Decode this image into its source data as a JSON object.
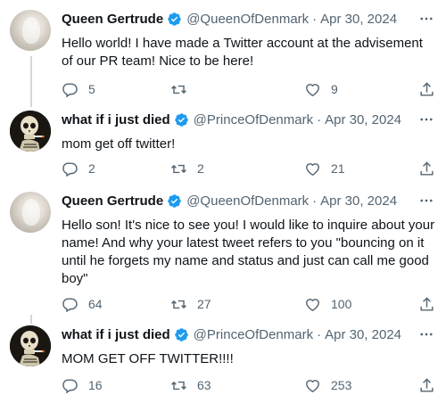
{
  "tweets": [
    {
      "name": "Queen Gertrude",
      "handle": "@QueenOfDenmark",
      "separator": "·",
      "date": "Apr 30, 2024",
      "text": "Hello world! I have made a Twitter account at the advisement of our PR team! Nice to be here!",
      "replies": "5",
      "retweets": "",
      "likes": "9",
      "avatar": "woman-portrait"
    },
    {
      "name": "what if i just died",
      "handle": "@PrinceOfDenmark",
      "separator": "·",
      "date": "Apr 30, 2024",
      "text": "mom get off twitter!",
      "replies": "2",
      "retweets": "2",
      "likes": "21",
      "avatar": "smoking-skeleton"
    },
    {
      "name": "Queen Gertrude",
      "handle": "@QueenOfDenmark",
      "separator": "·",
      "date": "Apr 30, 2024",
      "text": "Hello son! It's nice to see you! I would like to inquire about your name! And why your latest tweet refers to you \"bouncing on it until he forgets my name and status and just can call me good boy\"",
      "replies": "64",
      "retweets": "27",
      "likes": "100",
      "avatar": "woman-portrait"
    },
    {
      "name": "what if i just died",
      "handle": "@PrinceOfDenmark",
      "separator": "·",
      "date": "Apr 30, 2024",
      "text": "MOM GET OFF TWITTER!!!!",
      "replies": "16",
      "retweets": "63",
      "likes": "253",
      "avatar": "smoking-skeleton"
    }
  ],
  "icons": {
    "more": "more-horizontal-icon",
    "verified": "verified-badge-icon",
    "reply": "reply-icon",
    "retweet": "retweet-icon",
    "like": "heart-icon",
    "share": "share-icon"
  },
  "colors": {
    "verified": "#1d9bf0",
    "text": "#0f1419",
    "secondary": "#536471",
    "thread_line": "#cfd9de"
  }
}
